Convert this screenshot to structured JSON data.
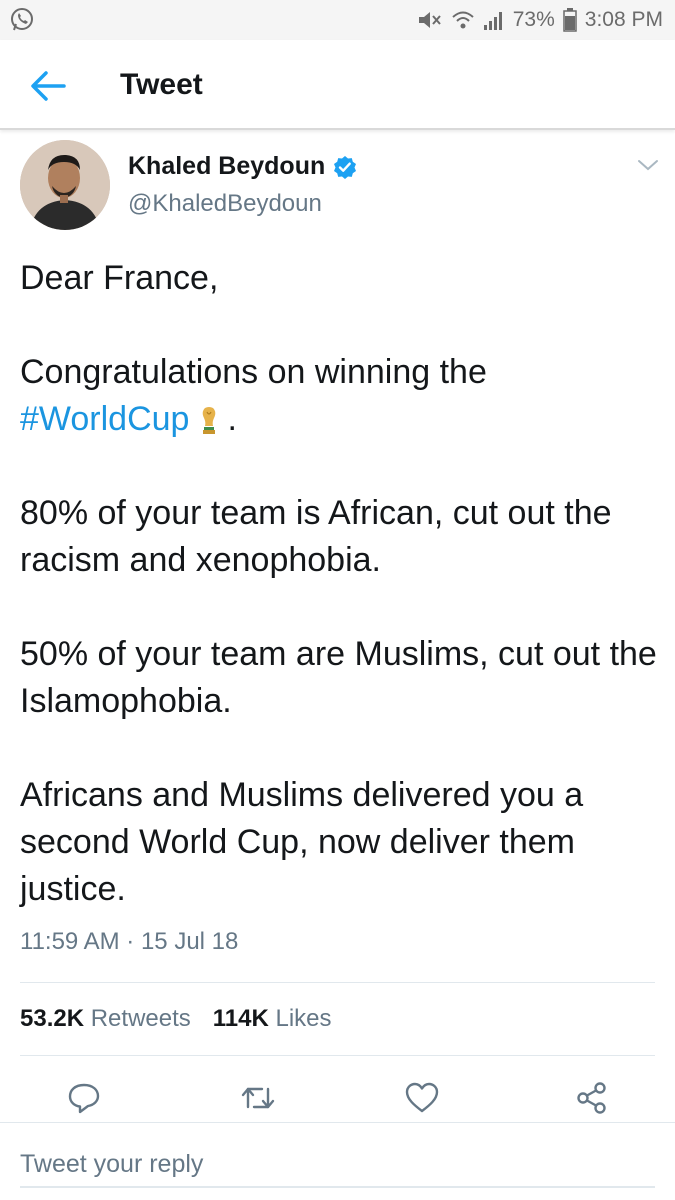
{
  "status_bar": {
    "battery": "73%",
    "time": "3:08 PM"
  },
  "header": {
    "title": "Tweet"
  },
  "tweet": {
    "author_name": "Khaled Beydoun",
    "handle": "@KhaledBeydoun",
    "text": {
      "p1": "Dear France,",
      "p2_a": "Congratulations on winning the",
      "p2_hashtag": "#WorldCup",
      "p2_end": ".",
      "p3": "80% of your team is African, cut out the racism and xenophobia.",
      "p4": "50% of your team are Muslims, cut out the Islamophobia.",
      "p5": "Africans and Muslims delivered you a second World Cup, now deliver them justice."
    },
    "timestamp": "11:59 AM · 15 Jul 18",
    "retweets_count": "53.2K",
    "retweets_label": "Retweets",
    "likes_count": "114K",
    "likes_label": "Likes"
  },
  "reply": {
    "placeholder": "Tweet your reply"
  },
  "colors": {
    "accent": "#1da1f2",
    "hashtag": "#1b95e0",
    "secondary_text": "#657786",
    "divider": "#e1e8ed"
  },
  "icons": {
    "status_app": "whatsapp-icon",
    "back": "arrow-left-icon",
    "verified": "verified-badge-icon",
    "caret": "chevron-down-icon",
    "reply": "reply-icon",
    "retweet": "retweet-icon",
    "like": "heart-icon",
    "share": "share-icon",
    "emoji": "trophy-icon"
  }
}
